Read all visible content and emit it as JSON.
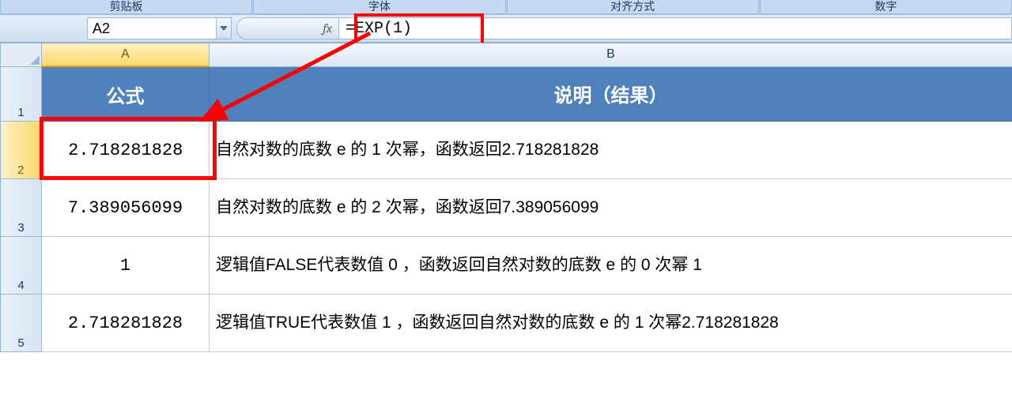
{
  "ribbon": {
    "groups": [
      "剪贴板",
      "字体",
      "对齐方式",
      "数字"
    ]
  },
  "formula_bar": {
    "name_box": "A2",
    "fx_label": "fx",
    "formula": "=EXP(1)"
  },
  "columns": {
    "A": "A",
    "B": "B"
  },
  "row_numbers": [
    "1",
    "2",
    "3",
    "4",
    "5"
  ],
  "table": {
    "header": {
      "A": "公式",
      "B": "说明（结果）"
    },
    "rows": [
      {
        "A": "2.718281828",
        "B": "自然对数的底数 e 的 1 次幂，函数返回2.718281828"
      },
      {
        "A": "7.389056099",
        "B": "自然对数的底数 e 的 2 次幂，函数返回7.389056099"
      },
      {
        "A": "1",
        "B": "逻辑值FALSE代表数值 0 ，函数返回自然对数的底数 e 的 0 次幂 1"
      },
      {
        "A": "2.718281828",
        "B": "逻辑值TRUE代表数值 1 ，函数返回自然对数的底数 e 的 1 次幂2.718281828"
      }
    ]
  },
  "active": {
    "row": 2,
    "col": "A"
  }
}
